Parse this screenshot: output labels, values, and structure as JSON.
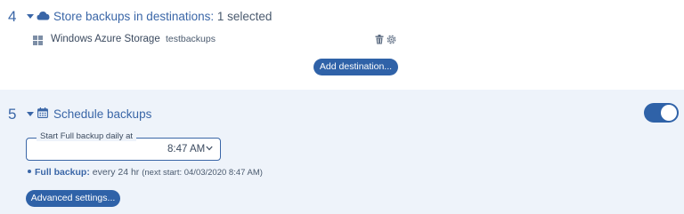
{
  "destinations": {
    "step_number": "4",
    "title": "Store backups in destinations:",
    "subtitle": "1 selected",
    "items": [
      {
        "name": "Windows Azure Storage",
        "container": "testbackups",
        "icon": "windows-icon"
      }
    ],
    "add_button_label": "Add destination..."
  },
  "schedule": {
    "step_number": "5",
    "title": "Schedule backups",
    "enabled": true,
    "field_label": "Start Full backup daily at",
    "time_value": "8:47 AM",
    "info_label": "Full backup:",
    "info_text": "every 24 hr",
    "next_start": "(next start: 04/03/2020 8:47 AM)",
    "advanced_button_label": "Advanced settings..."
  },
  "colors": {
    "accent": "#2f62a8",
    "section_bg": "#eef3fa"
  }
}
